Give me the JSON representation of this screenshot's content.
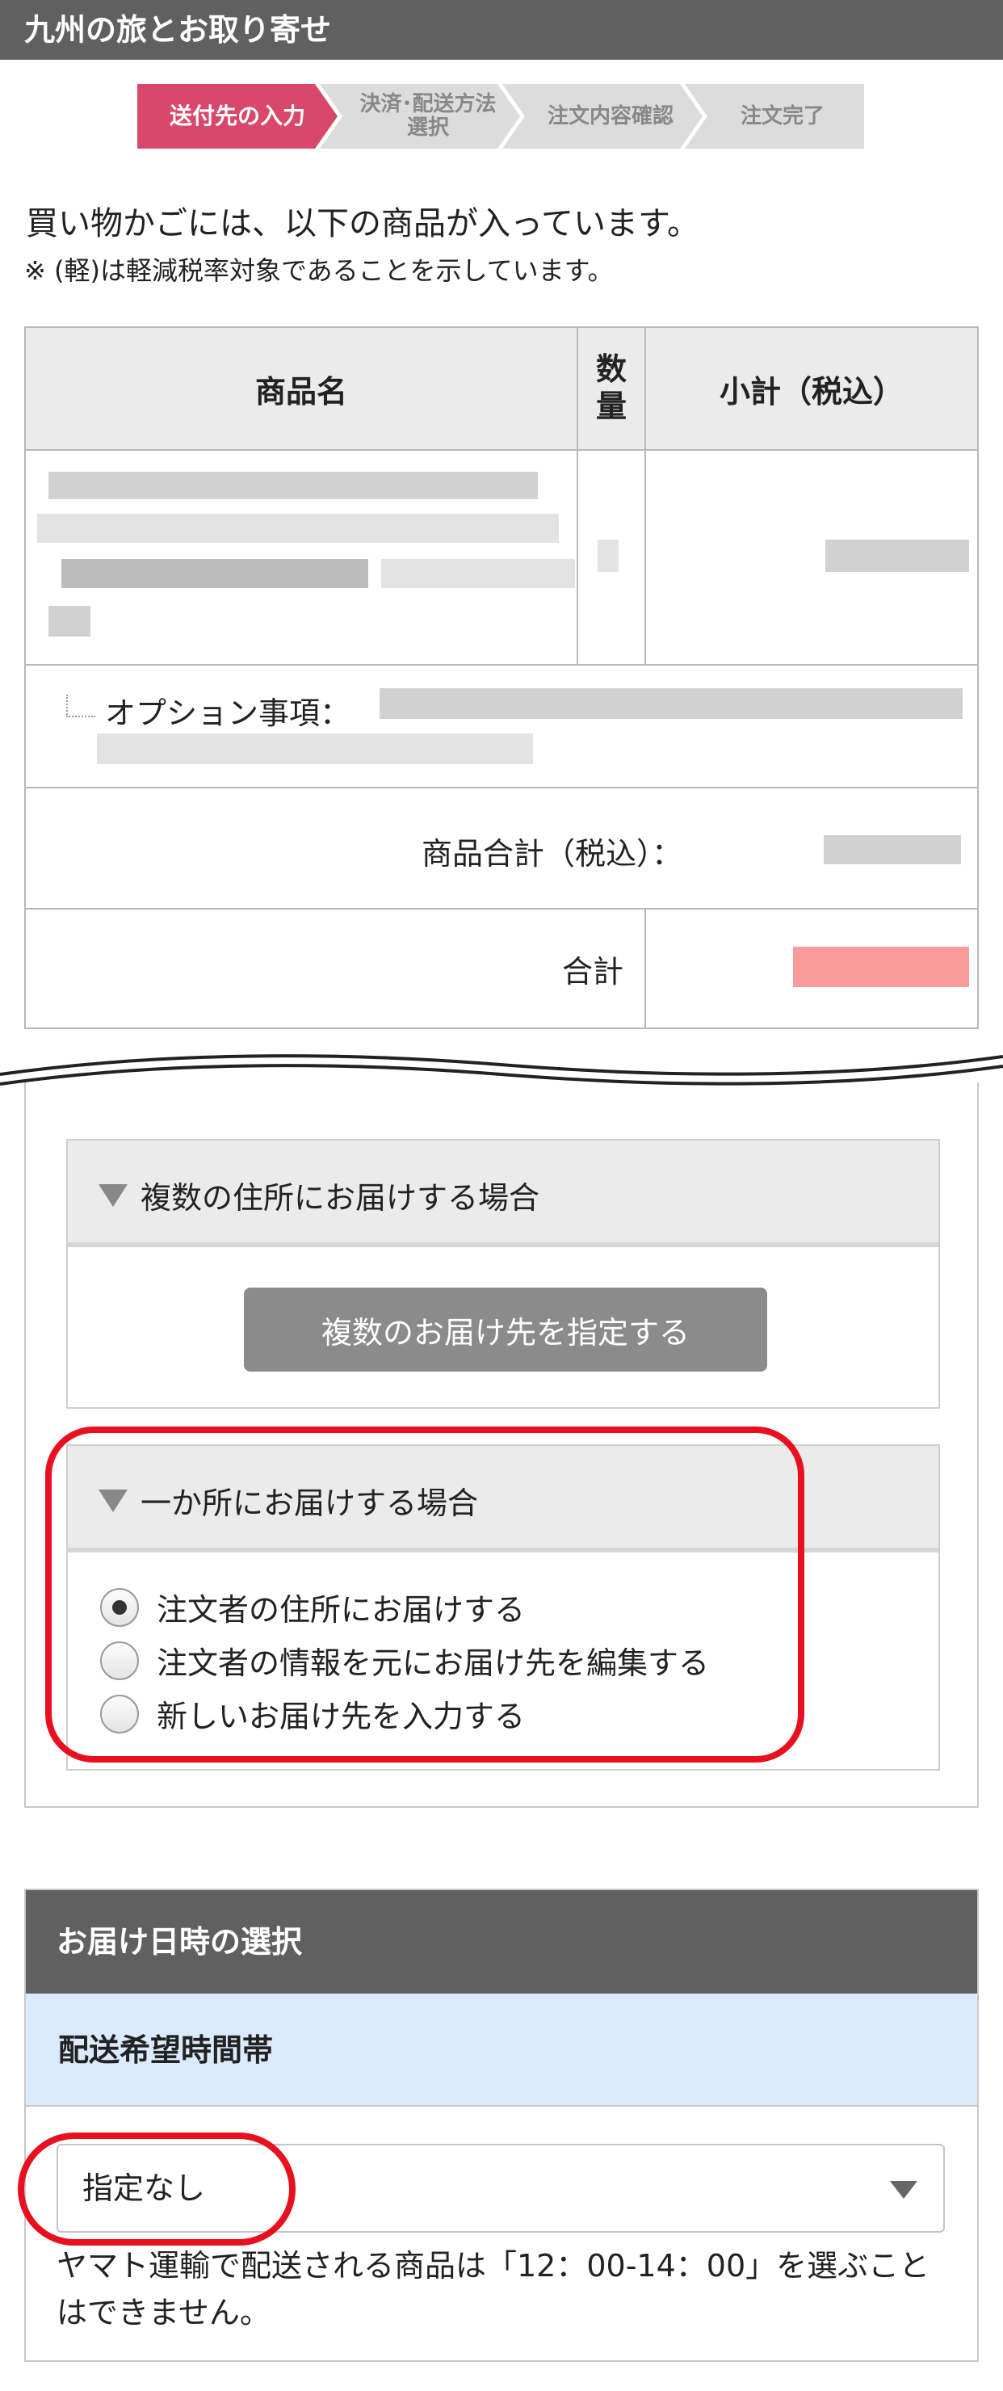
{
  "app": {
    "title": "九州の旅とお取り寄せ"
  },
  "steps": [
    {
      "label": "送付先の入力",
      "active": true
    },
    {
      "label": "決済･配送方法\n選択",
      "active": false
    },
    {
      "label": "注文内容確認",
      "active": false
    },
    {
      "label": "注文完了",
      "active": false
    }
  ],
  "intro": {
    "line1": "買い物かごには、以下の商品が入っています。",
    "line2": "※ (軽)は軽減税率対象であることを示しています。"
  },
  "cart": {
    "headers": {
      "name": "商品名",
      "qty_1": "数",
      "qty_2": "量",
      "subtotal": "小計（税込）"
    },
    "option_label": "オプション事項：",
    "sum_label": "商品合計（税込）：",
    "total_label": "合計"
  },
  "shipping": {
    "multiple": {
      "title": "複数の住所にお届けする場合",
      "button": "複数のお届け先を指定する"
    },
    "single": {
      "title": "一か所にお届けする場合",
      "options": [
        {
          "label": "注文者の住所にお届けする",
          "checked": true
        },
        {
          "label": "注文者の情報を元にお届け先を編集する",
          "checked": false
        },
        {
          "label": "新しいお届け先を入力する",
          "checked": false
        }
      ]
    }
  },
  "delivery": {
    "title": "お届け日時の選択",
    "time_label": "配送希望時間帯",
    "time_value": "指定なし",
    "note": "ヤマト運輸で配送される商品は「12：00-14：00」を選ぶことはできません。"
  },
  "colors": {
    "header_bg": "#606060",
    "active_step": "#d9476b",
    "callout": "#e8101e",
    "sub_header_bg": "#dbeafc"
  }
}
